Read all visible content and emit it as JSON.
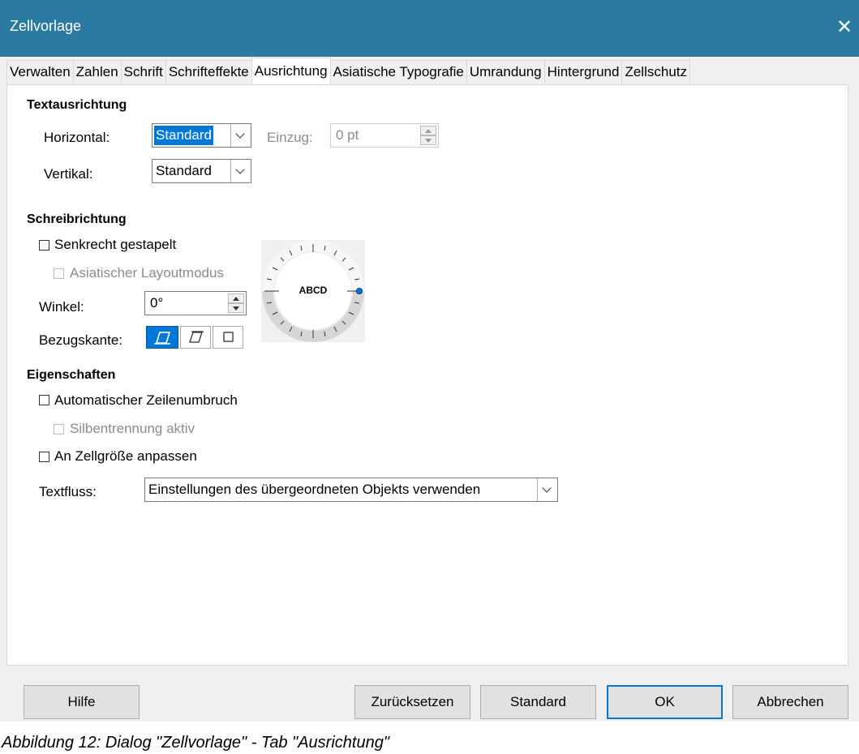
{
  "window": {
    "title": "Zellvorlage"
  },
  "tabs": [
    "Verwalten",
    "Zahlen",
    "Schrift",
    "Schrifteffekte",
    "Ausrichtung",
    "Asiatische Typografie",
    "Umrandung",
    "Hintergrund",
    "Zellschutz"
  ],
  "active_tab": "Ausrichtung",
  "text_alignment": {
    "heading": "Textausrichtung",
    "horizontal_label": "Horizontal:",
    "horizontal_value": "Standard",
    "indent_label": "Einzug:",
    "indent_value": "0 pt",
    "vertical_label": "Vertikal:",
    "vertical_value": "Standard"
  },
  "writing_direction": {
    "heading": "Schreibrichtung",
    "stacked_label": "Senkrecht gestapelt",
    "stacked_checked": false,
    "asian_layout_label": "Asiatischer Layoutmodus",
    "asian_layout_checked": false,
    "angle_label": "Winkel:",
    "angle_value": "0°",
    "reference_edge_label": "Bezugskante:",
    "dial_text": "ABCD",
    "dial_angle_deg": 0
  },
  "properties": {
    "heading": "Eigenschaften",
    "wrap_label": "Automatischer Zeilenumbruch",
    "wrap_checked": false,
    "hyphenation_label": "Silbentrennung aktiv",
    "hyphenation_checked": false,
    "shrink_label": "An Zellgröße anpassen",
    "shrink_checked": false,
    "textflow_label": "Textfluss:",
    "textflow_value": "Einstellungen des übergeordneten Objekts verwenden"
  },
  "buttons": {
    "help": "Hilfe",
    "reset": "Zurücksetzen",
    "standard": "Standard",
    "ok": "OK",
    "cancel": "Abbrechen"
  },
  "caption": "Abbildung 12: Dialog \"Zellvorlage\" - Tab \"Ausrichtung\"",
  "colors": {
    "titlebar": "#2b7aa1",
    "accent": "#0078d7"
  }
}
